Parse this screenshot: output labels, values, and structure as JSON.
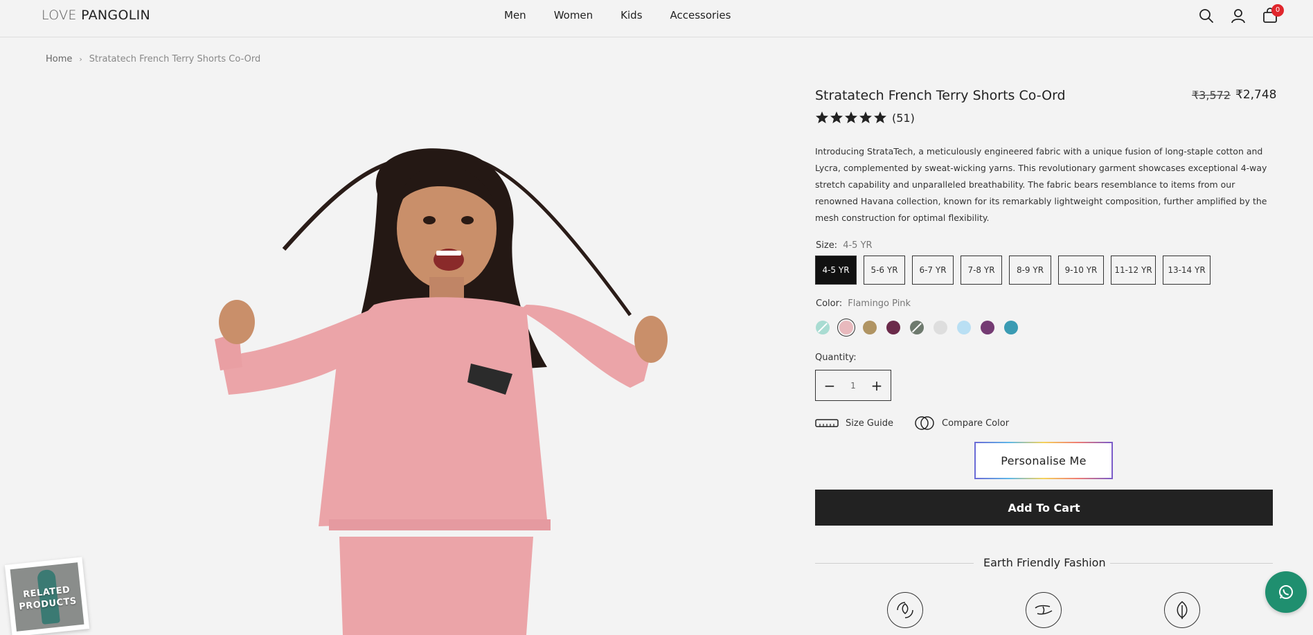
{
  "header": {
    "logo_part1": "LOVE",
    "logo_part2": "PANGOLIN",
    "nav": [
      "Men",
      "Women",
      "Kids",
      "Accessories"
    ],
    "cart_count": "0"
  },
  "breadcrumb": {
    "home": "Home",
    "current": "Stratatech French Terry Shorts Co-Ord"
  },
  "product": {
    "title": "Stratatech French Terry Shorts Co-Ord",
    "old_price": "₹3,572",
    "new_price": "₹2,748",
    "rating": 5,
    "review_count": "(51)",
    "description": "Introducing StrataTech, a meticulously engineered fabric with a unique fusion of long-staple cotton and Lycra, complemented by sweat-wicking yarns. This revolutionary garment showcases exceptional 4-way stretch capability and unparalleled breathability. The fabric bears resemblance to items from our renowned Havana collection, known for its remarkably lightweight composition, further amplified by the mesh construction for optimal flexibility.",
    "size_label": "Size:",
    "size_selected": "4-5 YR",
    "sizes": [
      "4-5 YR",
      "5-6 YR",
      "6-7 YR",
      "7-8 YR",
      "8-9 YR",
      "9-10 YR",
      "11-12 YR",
      "13-14 YR"
    ],
    "color_label": "Color:",
    "color_selected": "Flamingo Pink",
    "colors": [
      {
        "hex": "#a9dcd2",
        "unavailable": true
      },
      {
        "hex": "#e8b9bd",
        "unavailable": false,
        "selected": true
      },
      {
        "hex": "#b09463",
        "unavailable": false
      },
      {
        "hex": "#6b2a4a",
        "unavailable": false
      },
      {
        "hex": "#6e7a6e",
        "unavailable": true
      },
      {
        "hex": "#dedede",
        "unavailable": false
      },
      {
        "hex": "#b9dff3",
        "unavailable": false
      },
      {
        "hex": "#743b73",
        "unavailable": false
      },
      {
        "hex": "#3a9bb3",
        "unavailable": false
      }
    ],
    "quantity_label": "Quantity:",
    "quantity": "1",
    "size_guide": "Size Guide",
    "compare_color": "Compare Color",
    "personalise": "Personalise Me",
    "add_to_cart": "Add To Cart",
    "earth_friendly": "Earth Friendly Fashion"
  },
  "related": {
    "label_line1": "RELATED",
    "label_line2": "PRODUCTS"
  },
  "colors": {
    "background": "#f3f3f3",
    "button_dark": "#222222",
    "badge": "#e0262c",
    "whatsapp": "#1f8f6f",
    "garment_pink": "#eba4a8"
  }
}
